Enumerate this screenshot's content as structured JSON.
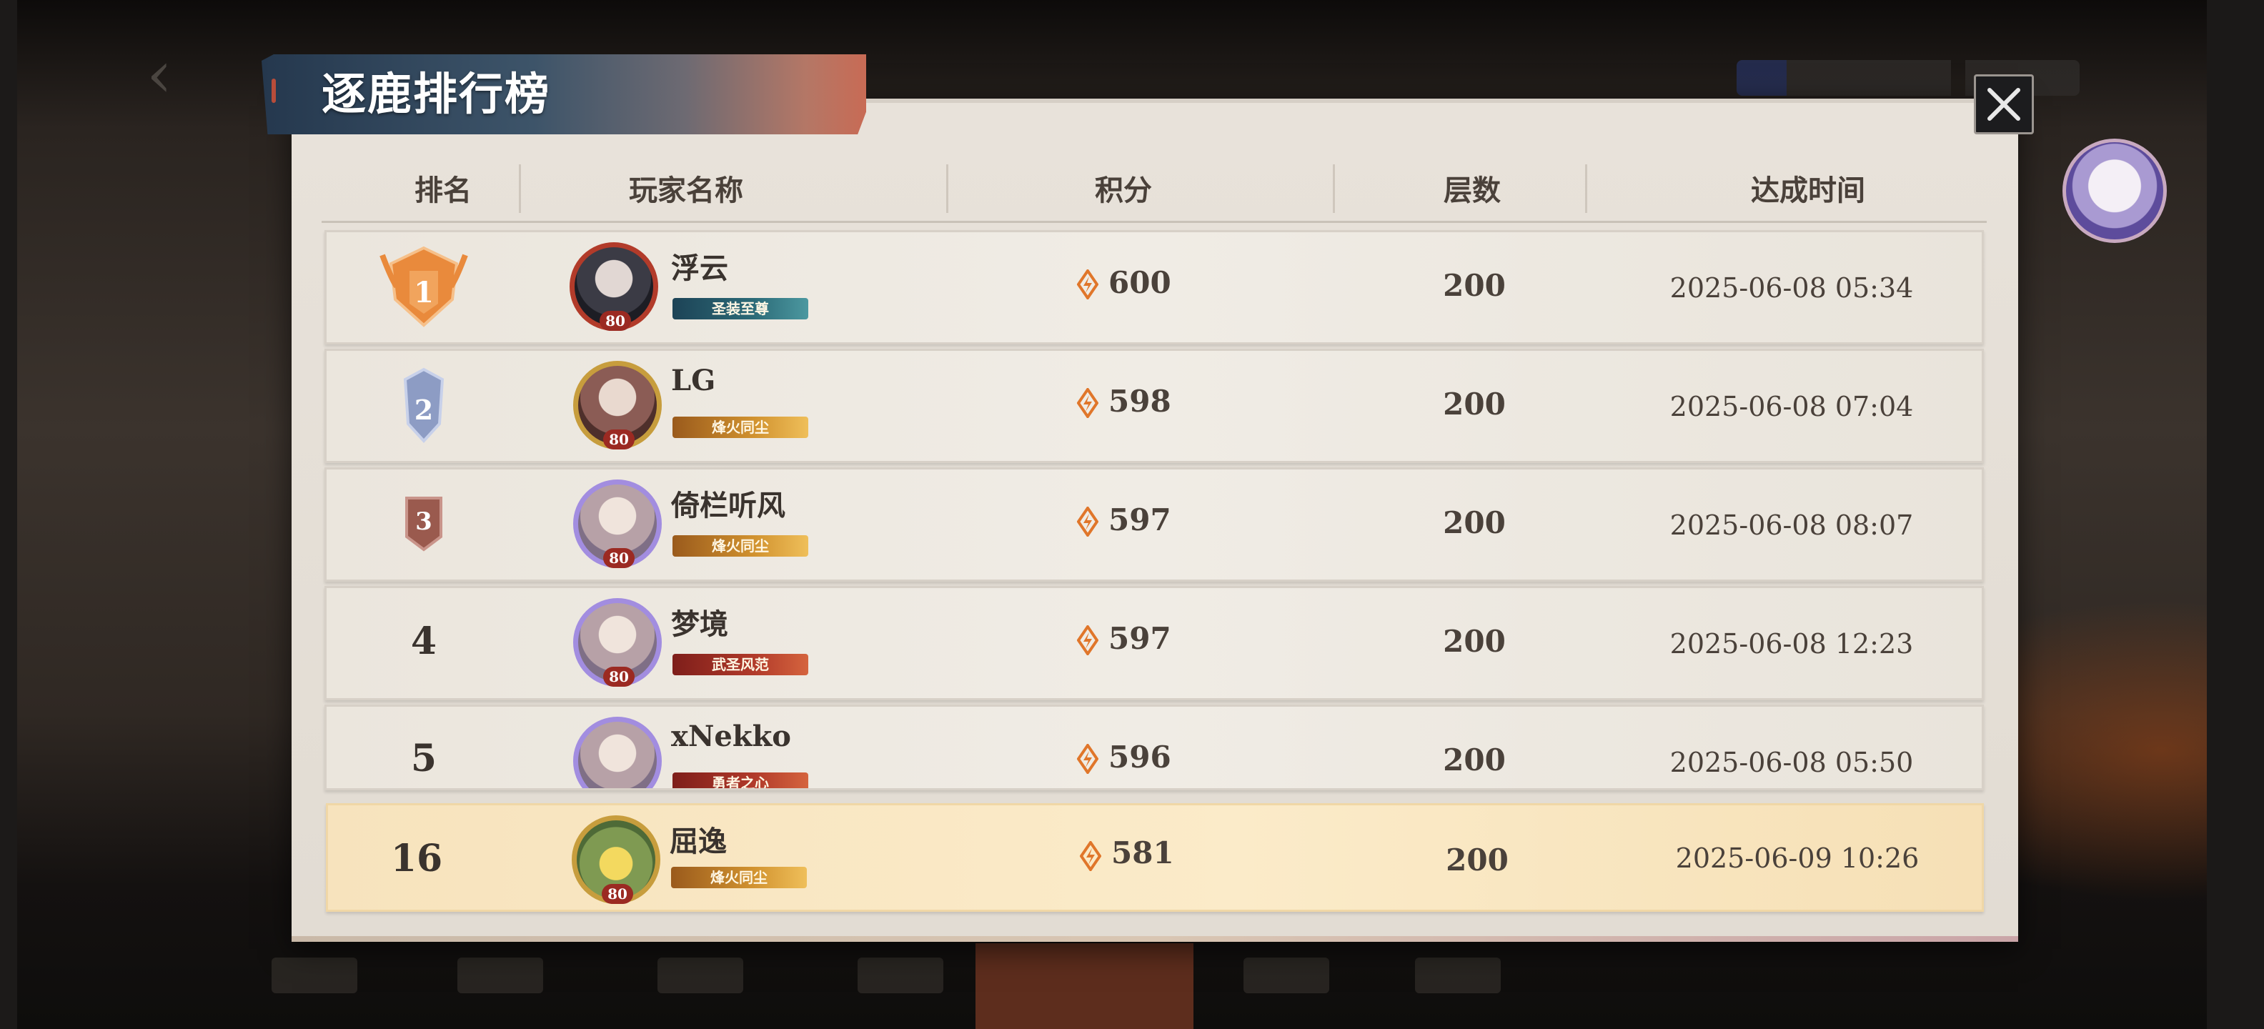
{
  "title": "逐鹿排行榜",
  "headers": {
    "rank": "排名",
    "player_name": "玩家名称",
    "score": "积分",
    "layers": "层数",
    "time": "达成时间"
  },
  "rows": [
    {
      "rank": "1",
      "name": "浮云",
      "level": "80",
      "title": "圣装至尊",
      "score": "600",
      "layers": "200",
      "time": "2025-06-08 05:34"
    },
    {
      "rank": "2",
      "name": "LG",
      "level": "80",
      "title": "烽火同尘",
      "score": "598",
      "layers": "200",
      "time": "2025-06-08 07:04"
    },
    {
      "rank": "3",
      "name": "倚栏听风",
      "level": "80",
      "title": "烽火同尘",
      "score": "597",
      "layers": "200",
      "time": "2025-06-08 08:07"
    },
    {
      "rank": "4",
      "name": "梦境",
      "level": "80",
      "title": "武圣风范",
      "score": "597",
      "layers": "200",
      "time": "2025-06-08 12:23"
    },
    {
      "rank": "5",
      "name": "xNekko",
      "level": "80",
      "title": "勇者之心",
      "score": "596",
      "layers": "200",
      "time": "2025-06-08 05:50"
    }
  ],
  "my_row": {
    "rank": "16",
    "name": "屈逸",
    "level": "80",
    "title": "烽火同尘",
    "score": "581",
    "layers": "200",
    "time": "2025-06-09 10:26"
  },
  "colors": {
    "panel_bg": "#e8e2da",
    "highlight_row": "#fbebc9",
    "score_icon": "#e0762a",
    "rank1_medal": "#e98a3c",
    "rank2_medal": "#8d9cc4",
    "rank3_medal": "#9a5a4e"
  },
  "icons": {
    "close": "close-icon",
    "score": "score-flame-icon",
    "rank1": "gold-medal-icon",
    "rank2": "silver-medal-icon",
    "rank3": "bronze-medal-icon"
  }
}
